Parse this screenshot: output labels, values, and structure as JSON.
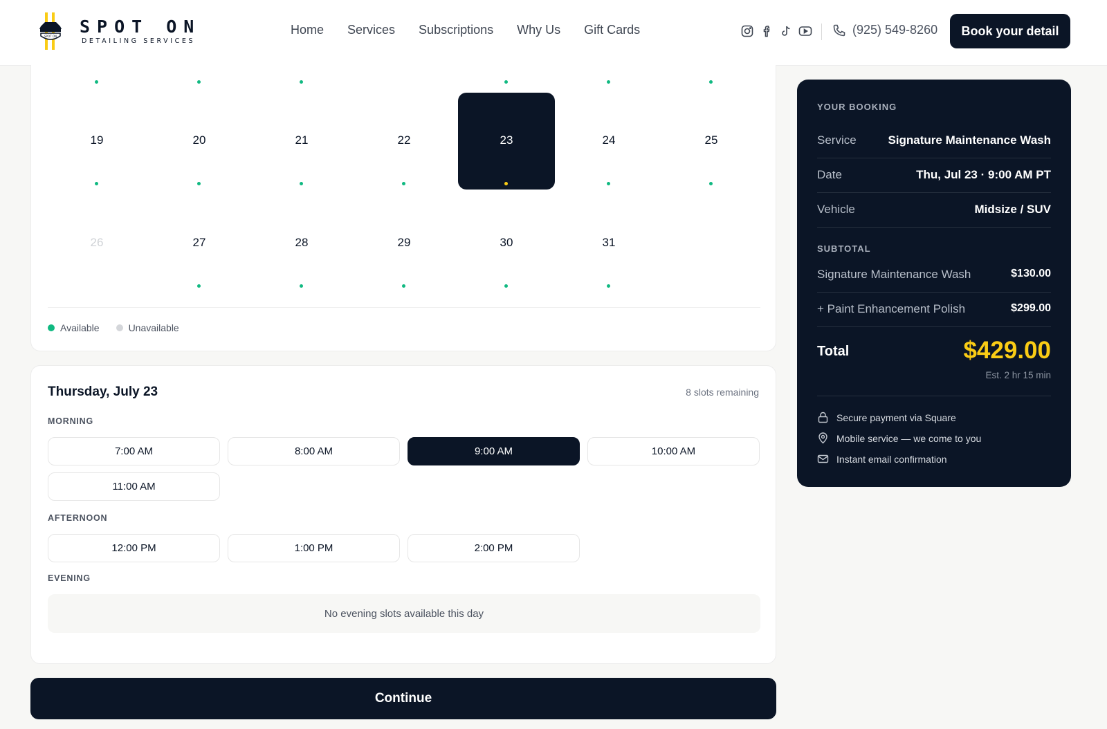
{
  "brand": {
    "title": "SPOT ON",
    "subtitle": "DETAILING SERVICES",
    "mark_text": "SPOT ON"
  },
  "nav": [
    "Home",
    "Services",
    "Subscriptions",
    "Why Us",
    "Gift Cards"
  ],
  "social": [
    "instagram-icon",
    "facebook-icon",
    "tiktok-icon",
    "youtube-icon"
  ],
  "phone": "(925) 549-8260",
  "book_label": "Book your detail",
  "calendar": {
    "weeks": [
      [
        {
          "day": "19",
          "state": "available"
        },
        {
          "day": "20",
          "state": "available"
        },
        {
          "day": "21",
          "state": "available"
        },
        {
          "day": "22",
          "state": "available"
        },
        {
          "day": "23",
          "state": "selected"
        },
        {
          "day": "24",
          "state": "available"
        },
        {
          "day": "25",
          "state": "available"
        }
      ],
      [
        {
          "day": "26",
          "state": "unavailable"
        },
        {
          "day": "27",
          "state": "available"
        },
        {
          "day": "28",
          "state": "available"
        },
        {
          "day": "29",
          "state": "available"
        },
        {
          "day": "30",
          "state": "available"
        },
        {
          "day": "31",
          "state": "available"
        }
      ]
    ],
    "top_row_dots": [
      true,
      true,
      true,
      false,
      true,
      true,
      true
    ],
    "legend": {
      "available": "Available",
      "unavailable": "Unavailable"
    },
    "colors": {
      "available": "#10b981",
      "unavailable": "#d4d6da",
      "selected_dot": "#facc15"
    }
  },
  "slots": {
    "day_title": "Thursday, July 23",
    "remaining": "8 slots remaining",
    "morning_label": "MORNING",
    "morning": [
      "7:00 AM",
      "8:00 AM",
      "9:00 AM",
      "10:00 AM",
      "11:00 AM"
    ],
    "afternoon_label": "AFTERNOON",
    "afternoon": [
      "12:00 PM",
      "1:00 PM",
      "2:00 PM"
    ],
    "evening_label": "EVENING",
    "evening_empty": "No evening slots available this day",
    "selected": "9:00 AM"
  },
  "continue_label": "Continue",
  "summary": {
    "heading": "YOUR BOOKING",
    "service_k": "Service",
    "service_v": "Signature Maintenance Wash",
    "date_k": "Date",
    "date_v": "Thu, Jul 23 · 9:00 AM PT",
    "vehicle_k": "Vehicle",
    "vehicle_v": "Midsize / SUV",
    "subtotal_heading": "SUBTOTAL",
    "line1_k": "Signature Maintenance Wash",
    "line1_v": "$130.00",
    "line2_k": "+ Paint Enhancement Polish",
    "line2_v": "$299.00",
    "total_k": "Total",
    "total_v": "$429.00",
    "est": "Est. 2 hr 15 min",
    "features": [
      "Secure payment via Square",
      "Mobile service — we come to you",
      "Instant email confirmation"
    ]
  },
  "colors": {
    "navy": "#0b1526",
    "accent_yellow": "#facc15",
    "available_green": "#10b981"
  }
}
